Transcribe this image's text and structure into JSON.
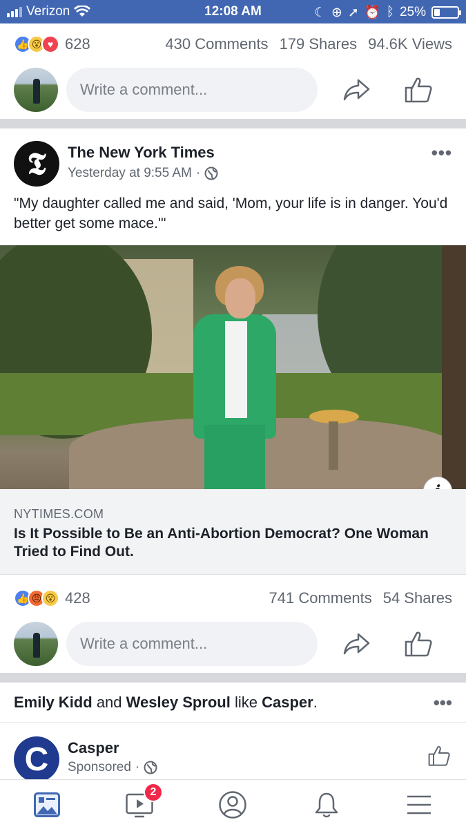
{
  "status": {
    "carrier": "Verizon",
    "time": "12:08 AM",
    "battery_percent": "25%",
    "battery_level": 0.25
  },
  "post1_footer": {
    "reaction_count": "628",
    "comments": "430 Comments",
    "shares": "179 Shares",
    "views": "94.6K Views",
    "comment_placeholder": "Write a comment..."
  },
  "post2": {
    "page_name": "The New York Times",
    "timestamp": "Yesterday at 9:55 AM",
    "text": "\"My daughter called me and said, 'Mom, your life is in danger. You'd better get some mace.'\"",
    "link_domain": "NYTIMES.COM",
    "link_title": "Is It Possible to Be an Anti-Abortion Democrat? One Woman Tried to Find Out.",
    "reaction_count": "428",
    "comments": "741 Comments",
    "shares": "54 Shares",
    "comment_placeholder": "Write a comment..."
  },
  "post3": {
    "friend1": "Emily Kidd",
    "and_word": "and",
    "friend2": "Wesley Sproul",
    "like_word": "like",
    "liked_page": "Casper",
    "page_name": "Casper",
    "sponsored": "Sponsored"
  },
  "tabbar": {
    "video_badge": "2",
    "tabs": [
      "news-feed",
      "watch",
      "profile",
      "notifications",
      "menu"
    ]
  },
  "colors": {
    "brand": "#4267b2",
    "like_blue": "#4a80f0",
    "badge_red": "#f02849"
  }
}
